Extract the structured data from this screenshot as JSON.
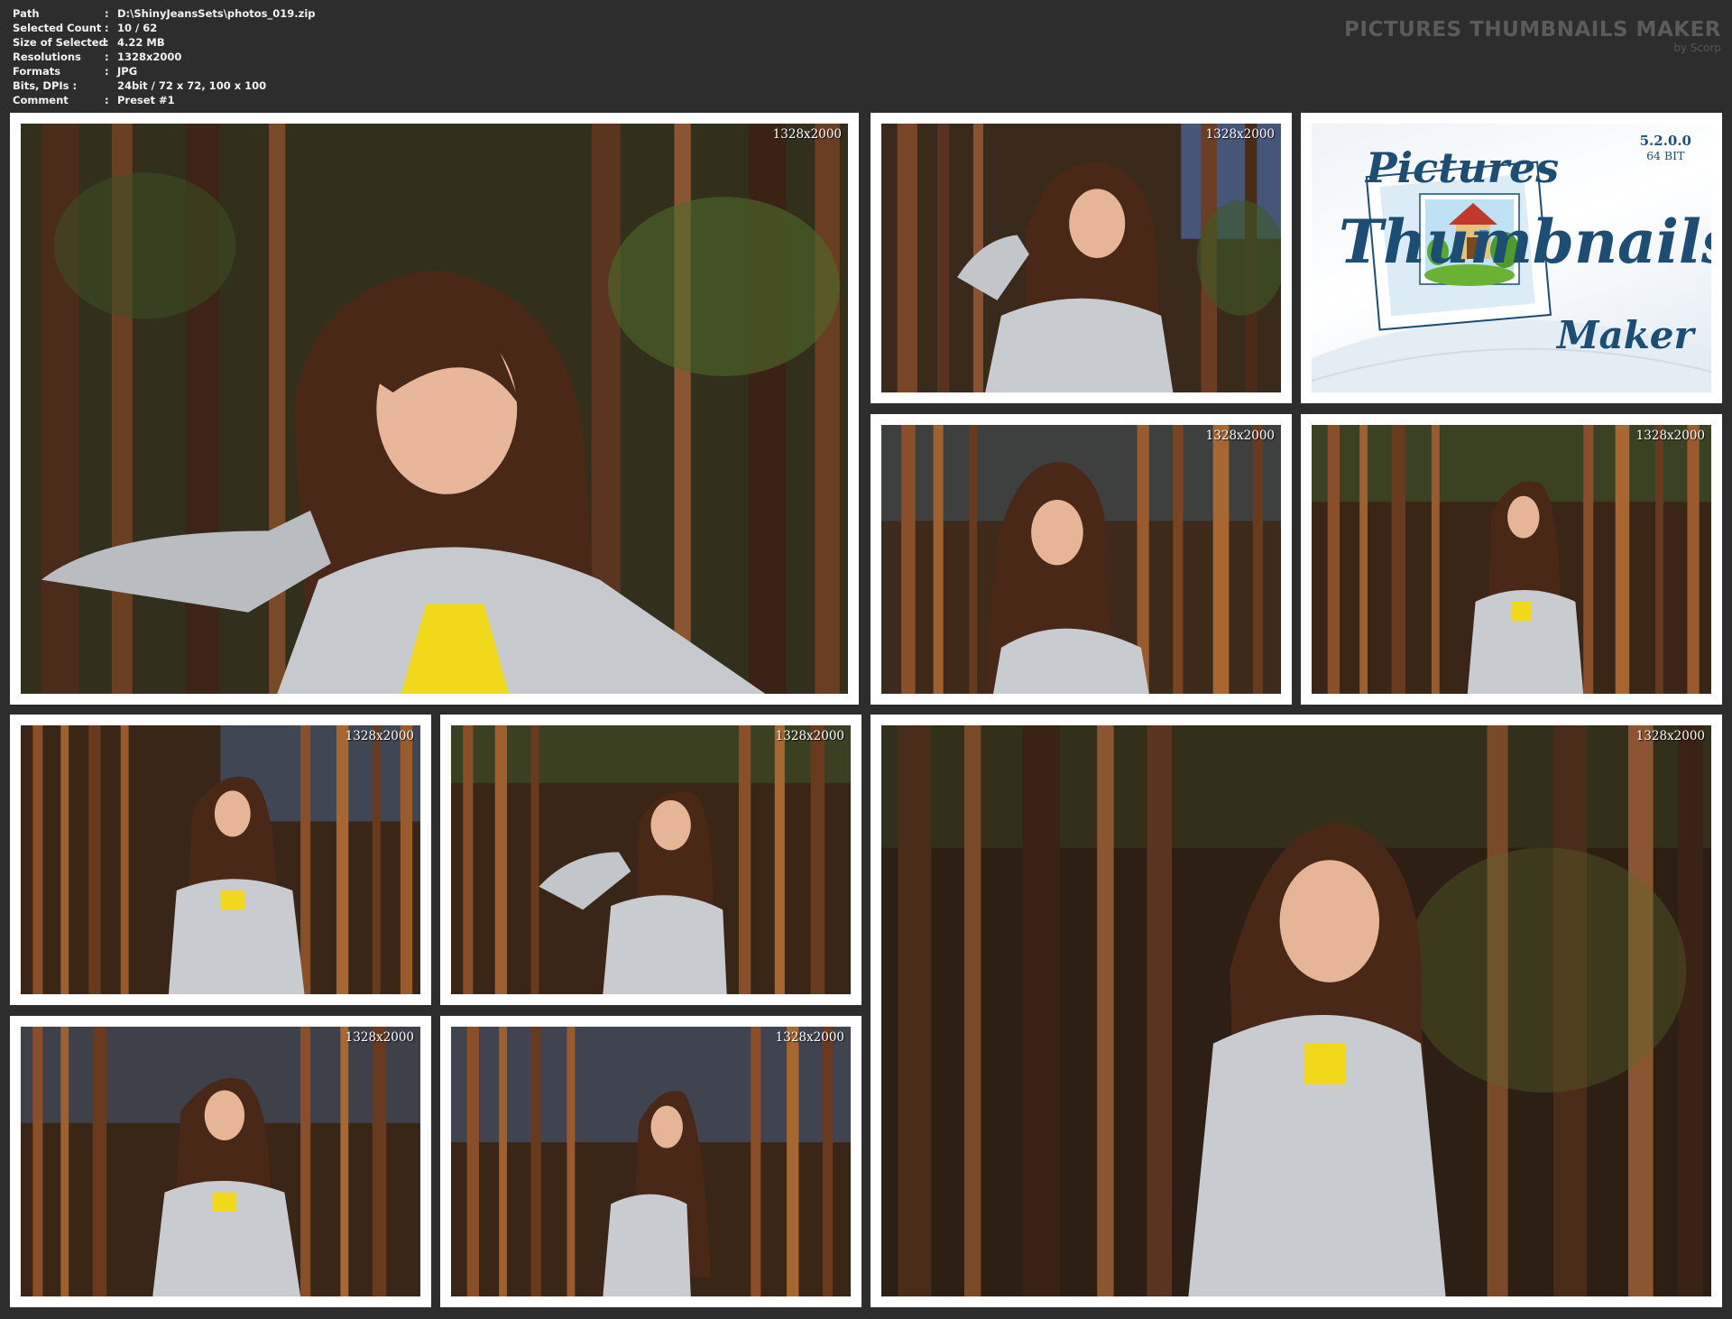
{
  "info": {
    "rows": [
      {
        "key": "Path",
        "sep": ":",
        "value": "D:\\ShinyJeansSets\\photos_019.zip"
      },
      {
        "key": "Selected Count",
        "sep": ":",
        "value": "10 / 62"
      },
      {
        "key": "Size of Selected",
        "sep": ":",
        "value": "4.22 MB"
      },
      {
        "key": "Resolutions",
        "sep": ":",
        "value": "1328x2000"
      },
      {
        "key": "Formats",
        "sep": ":",
        "value": "JPG"
      },
      {
        "key": "Bits, DPIs :",
        "sep": ":",
        "value": "24bit / 72 x 72, 100 x 100"
      },
      {
        "key": "Comment",
        "sep": ":",
        "value": "Preset #1"
      }
    ]
  },
  "brand": {
    "title": "PICTURES THUMBNAILS MAKER",
    "subtitle": "by Scorp"
  },
  "logo": {
    "version": "5.2.0.0",
    "bits": "64 BIT",
    "word1": "Pictures",
    "word2": "Thumbnails",
    "word3": "Maker"
  },
  "thumbnails": [
    {
      "label": "1328x2000"
    },
    {
      "label": "1328x2000"
    },
    {
      "label": "1328x2000"
    },
    {
      "label": "1328x2000"
    },
    {
      "label": "1328x2000"
    },
    {
      "label": "1328x2000"
    },
    {
      "label": "1328x2000"
    },
    {
      "label": "1328x2000"
    },
    {
      "label": "1328x2000"
    }
  ],
  "colors": {
    "background": "#2d2d2d",
    "frame": "#ffffff",
    "forest_dark": "#2a1d14",
    "jacket_silver": "#c9cdd2",
    "shirt_yellow": "#f0d81f",
    "logo_blue": "#1b4d75"
  }
}
